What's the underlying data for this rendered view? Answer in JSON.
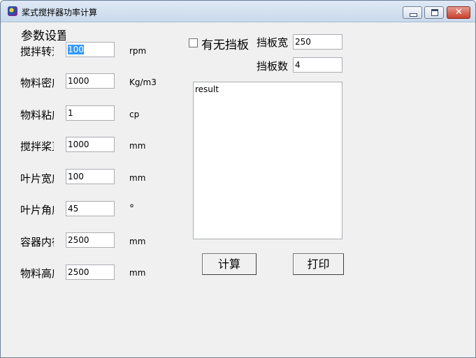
{
  "window": {
    "title": "桨式搅拌器功率计算"
  },
  "params": {
    "section_title": "参数设置",
    "rows": [
      {
        "label": "搅拌转速",
        "value": "100",
        "unit": "rpm"
      },
      {
        "label": "物料密度",
        "value": "1000",
        "unit": "Kg/m3"
      },
      {
        "label": "物料粘度",
        "value": "1",
        "unit": "cp"
      },
      {
        "label": "搅拌桨直径",
        "value": "1000",
        "unit": "mm"
      },
      {
        "label": "叶片宽度",
        "value": "100",
        "unit": "mm"
      },
      {
        "label": "叶片角度",
        "value": "45",
        "unit": "°"
      },
      {
        "label": "容器内径",
        "value": "2500",
        "unit": "mm"
      },
      {
        "label": "物料高度",
        "value": "2500",
        "unit": "mm"
      }
    ]
  },
  "baffle": {
    "checkbox_label": "有无挡板",
    "width_label": "挡板宽度",
    "width_value": "250",
    "count_label": "挡板数",
    "count_value": "4"
  },
  "output": {
    "result_text": "result"
  },
  "buttons": {
    "calculate": "计算",
    "print": "打印"
  }
}
